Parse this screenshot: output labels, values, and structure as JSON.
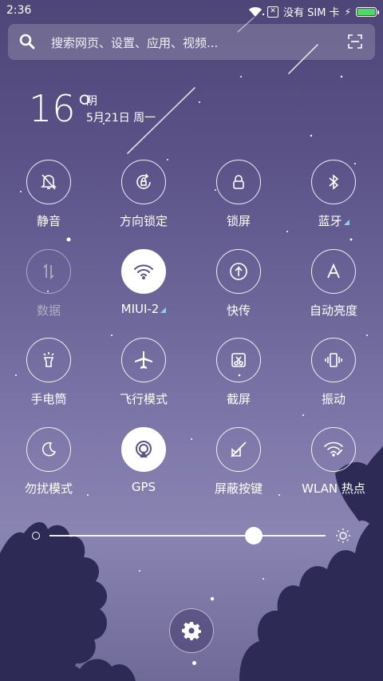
{
  "status": {
    "time": "2:36",
    "sim_text": "没有 SIM 卡"
  },
  "search": {
    "placeholder": "搜索网页、设置、应用、视频..."
  },
  "weather": {
    "temp": "16°",
    "condition": "阴",
    "date": "5月21日 周一"
  },
  "toggles": [
    {
      "label": "静音",
      "icon": "silent-icon",
      "state": "off"
    },
    {
      "label": "方向锁定",
      "icon": "rotation-lock-icon",
      "state": "off"
    },
    {
      "label": "锁屏",
      "icon": "lock-icon",
      "state": "off"
    },
    {
      "label": "蓝牙",
      "icon": "bluetooth-icon",
      "state": "off",
      "has_more": true
    },
    {
      "label": "数据",
      "icon": "data-icon",
      "state": "disabled"
    },
    {
      "label": "MIUI-2",
      "icon": "wifi-icon",
      "state": "on",
      "has_more": true
    },
    {
      "label": "快传",
      "icon": "quick-transfer-icon",
      "state": "off"
    },
    {
      "label": "自动亮度",
      "icon": "auto-brightness-icon",
      "state": "off"
    },
    {
      "label": "手电筒",
      "icon": "flashlight-icon",
      "state": "off"
    },
    {
      "label": "飞行模式",
      "icon": "airplane-icon",
      "state": "off"
    },
    {
      "label": "截屏",
      "icon": "screenshot-icon",
      "state": "off"
    },
    {
      "label": "振动",
      "icon": "vibrate-icon",
      "state": "off"
    },
    {
      "label": "勿扰模式",
      "icon": "do-not-disturb-icon",
      "state": "off"
    },
    {
      "label": "GPS",
      "icon": "gps-icon",
      "state": "on"
    },
    {
      "label": "屏蔽按键",
      "icon": "block-keys-icon",
      "state": "off"
    },
    {
      "label": "WLAN 热点",
      "icon": "hotspot-icon",
      "state": "off"
    }
  ],
  "brightness": {
    "level": 0.74
  },
  "colors": {
    "accent_tri": "#7dd6f2",
    "battery": "#4cd964"
  }
}
